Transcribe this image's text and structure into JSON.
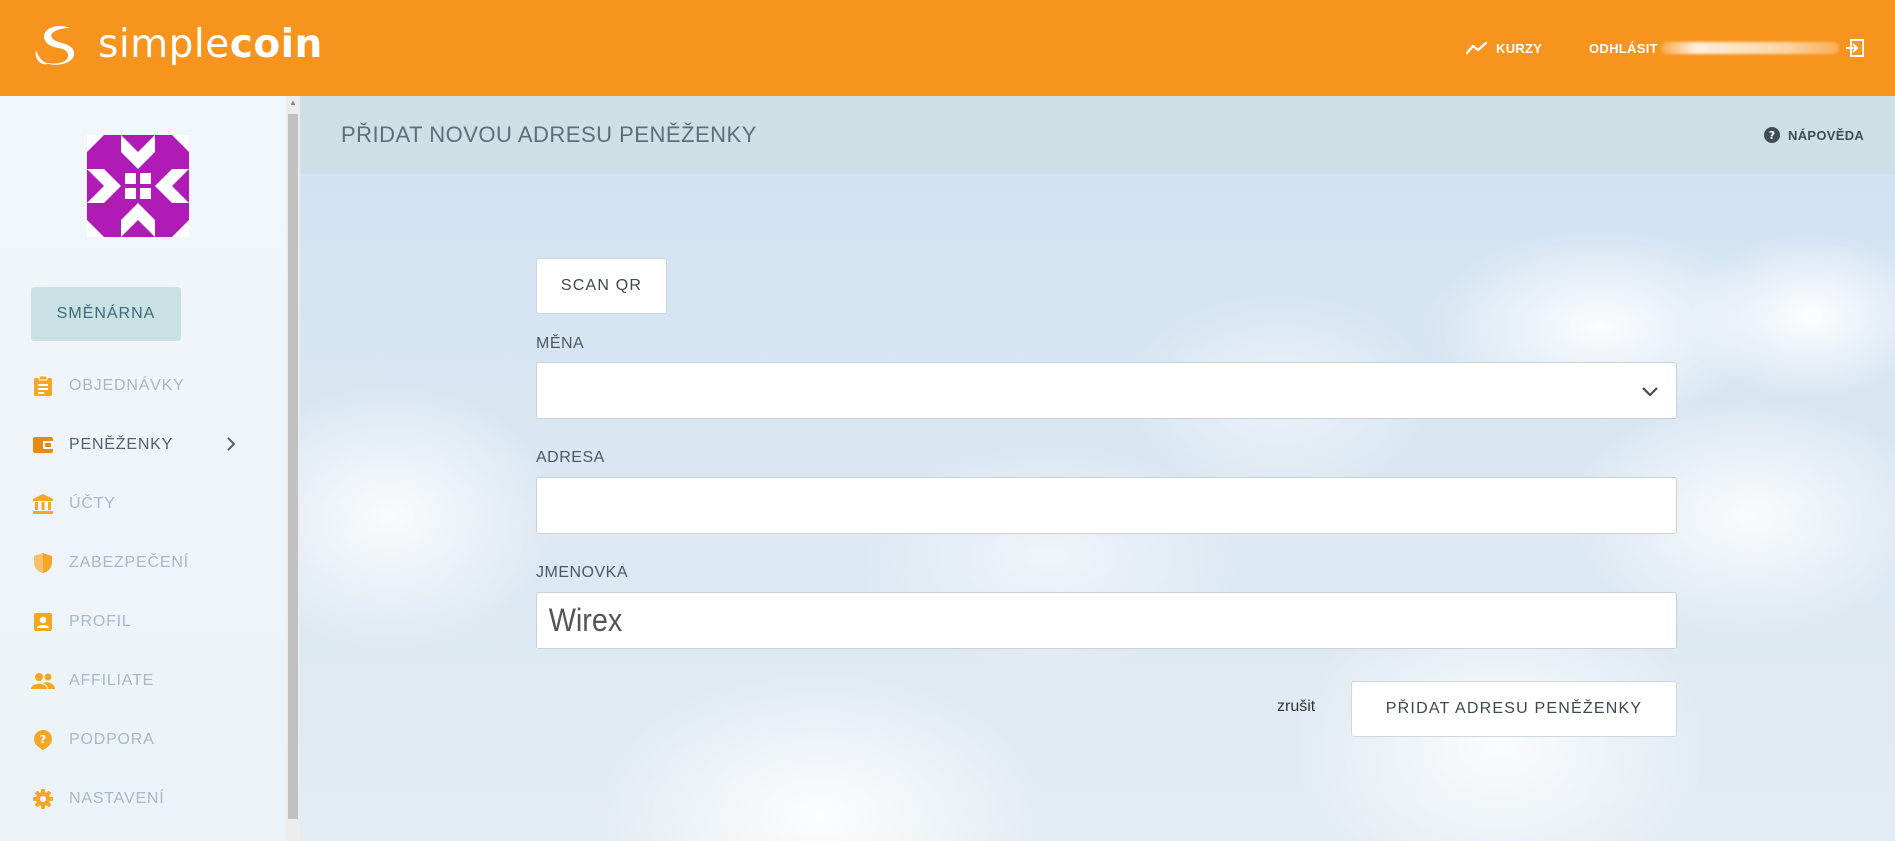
{
  "brand": {
    "name_thin": "simple",
    "name_bold": "coin"
  },
  "topnav": {
    "rates_label": "KURZY",
    "logout_label": "ODHLÁSIT"
  },
  "sidebar": {
    "exchange_button": "SMĚNÁRNA",
    "items": [
      {
        "label": "OBJEDNÁVKY",
        "icon": "clipboard-icon"
      },
      {
        "label": "PENĚŽENKY",
        "icon": "wallet-icon",
        "active": true
      },
      {
        "label": "ÚČTY",
        "icon": "bank-icon"
      },
      {
        "label": "ZABEZPEČENÍ",
        "icon": "shield-icon"
      },
      {
        "label": "PROFIL",
        "icon": "profile-icon"
      },
      {
        "label": "AFFILIATE",
        "icon": "people-icon"
      },
      {
        "label": "PODPORA",
        "icon": "support-icon"
      },
      {
        "label": "NASTAVENÍ",
        "icon": "gear-icon"
      }
    ]
  },
  "page": {
    "title": "PŘIDAT NOVOU ADRESU PENĚŽENKY",
    "help_label": "NÁPOVĚDA"
  },
  "form": {
    "scan_button": "SCAN QR",
    "currency_label": "MĚNA",
    "currency_value": "",
    "address_label": "ADRESA",
    "address_value": "",
    "name_label": "JMENOVKA",
    "name_value": "Wirex",
    "cancel_label": "zrušit",
    "submit_button": "PŘIDAT ADRESU PENĚŽENKY"
  },
  "colors": {
    "header": "#f7941d",
    "sidebar_icon": "#f5a623",
    "active_icon": "#e58a17",
    "avatar": "#b01bb6",
    "page_header": "#cde0e6"
  }
}
